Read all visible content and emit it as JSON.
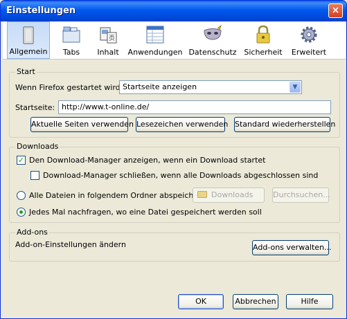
{
  "window": {
    "title": "Einstellungen",
    "close_glyph": "×"
  },
  "toolbar": {
    "items": [
      {
        "label": "Allgemein",
        "icon": "general-icon",
        "selected": true
      },
      {
        "label": "Tabs",
        "icon": "tabs-icon"
      },
      {
        "label": "Inhalt",
        "icon": "content-icon"
      },
      {
        "label": "Anwendungen",
        "icon": "applications-icon"
      },
      {
        "label": "Datenschutz",
        "icon": "privacy-mask-icon"
      },
      {
        "label": "Sicherheit",
        "icon": "security-lock-icon"
      },
      {
        "label": "Erweitert",
        "icon": "advanced-gear-icon"
      }
    ]
  },
  "start": {
    "title": "Start",
    "startup_label": "Wenn Firefox gestartet wird:",
    "startup_value": "Startseite anzeigen",
    "homepage_label": "Startseite:",
    "homepage_value": "http://www.t-online.de/",
    "btn_current": "Aktuelle Seiten verwenden",
    "btn_bookmark": "Lesezeichen verwenden",
    "btn_default": "Standard wiederherstellen"
  },
  "downloads": {
    "title": "Downloads",
    "show_manager": "Den Download-Manager anzeigen, wenn ein Download startet",
    "show_manager_checked": true,
    "close_manager": "Download-Manager schließen, wenn alle Downloads abgeschlossen sind",
    "close_manager_checked": false,
    "save_all": "Alle Dateien in folgendem Ordner abspeichern:",
    "folder": "Downloads",
    "browse": "Durchsuchen...",
    "ask_each": "Jedes Mal nachfragen, wo eine Datei gespeichert werden soll",
    "selected_option": "ask_each"
  },
  "addons": {
    "title": "Add-ons",
    "description": "Add-on-Einstellungen ändern",
    "btn_manage": "Add-ons verwalten..."
  },
  "footer": {
    "ok": "OK",
    "cancel": "Abbrechen",
    "help": "Hilfe"
  },
  "colors": {
    "accent": "#0058ee",
    "window_bg": "#ece9d8",
    "check_green": "#21a121"
  }
}
